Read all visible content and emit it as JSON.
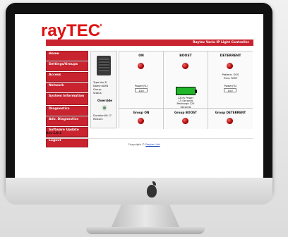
{
  "brand": {
    "name_ray": "ray",
    "name_tec": "TEC"
  },
  "header": {
    "title": "Raytec Vario IP Light Controller"
  },
  "sidebar": {
    "items": [
      {
        "label": "Home"
      },
      {
        "label": "Settings/Groups"
      },
      {
        "label": "Access"
      },
      {
        "label": "Network"
      },
      {
        "label": "System Information"
      },
      {
        "label": "Diagnostics"
      },
      {
        "label": "Adv. Diagnostics"
      },
      {
        "label": "Software Update"
      },
      {
        "label": "Logout"
      }
    ]
  },
  "device": {
    "type_line": "Type:Var B",
    "name_line": "Name:VAR3",
    "group_line": "Group:",
    "status_line": "Status:",
    "override_label": "Override",
    "duration_line": "Duration00:17",
    "restart_line": "Restart:"
  },
  "columns": [
    {
      "header": "ON",
      "power_label": "Power(%)",
      "power_value": "100",
      "group_label": "Group ON"
    },
    {
      "header": "BOOST",
      "info_lines": [
        "120% Power",
        "15 Seconds",
        "Recharge 120",
        "Seconds"
      ],
      "group_label": "Group BOOST"
    },
    {
      "header": "DETERRENT",
      "pattern": "Pattern: SOS",
      "freq": "Freq: FAST",
      "power_label": "Power(%)",
      "power_value": "100",
      "group_label": "Group DETERRENT"
    }
  ],
  "footer": {
    "revision": "Rev 1.0.1",
    "copyright_prefix": "Copyright ©",
    "copyright_link": "Raytec Ltd"
  },
  "colors": {
    "brand_red": "#c8232f",
    "battery_green": "#1fb62a"
  }
}
